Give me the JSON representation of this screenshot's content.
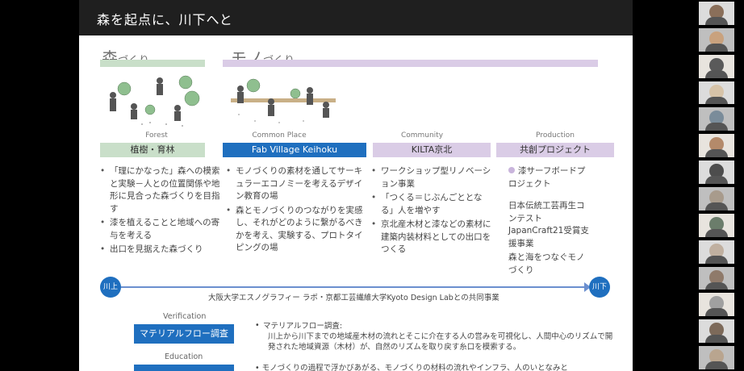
{
  "slide": {
    "title": "森を起点に、川下へと",
    "section_mori": {
      "main": "森",
      "sub": "づくり"
    },
    "section_mono": {
      "main": "モノ",
      "sub": "づくり"
    },
    "columns": [
      {
        "category": "Forest",
        "tag": "植樹・育林",
        "style": "green",
        "bullets": [
          "「理にかなった」森への模索と実験－人との位置関係や地形に見合った森づくりを目指す",
          "漆を植えることと地域への寄与を考える",
          "出口を見据えた森づくり"
        ]
      },
      {
        "category": "Common Place",
        "tag": "Fab Village Keihoku",
        "style": "blue",
        "bullets": [
          "モノづくりの素材を通してサーキュラーエコノミーを考えるデザイン教育の場",
          "森とモノづくりのつながりを実感し、それがどのように繋がるべきかを考え、実験する、プロトタイピングの場"
        ]
      },
      {
        "category": "Community",
        "tag": "KILTA京北",
        "style": "purple",
        "bullets": [
          "ワークショップ型リノベーション事業",
          "「つくる＝じぶんごととなる」人を増やす",
          "京北産木材と漆などの素材に建築内装材料としての出口をつくる"
        ]
      },
      {
        "category": "Production",
        "tag": "共創プロジェクト",
        "style": "purple",
        "items": [
          "漆サーフボードプロジェクト",
          "日本伝統工芸再生コンテストJapanCraft21受賞支援事業",
          "森と海をつなぐモノづくり"
        ]
      }
    ],
    "flow": {
      "start": "川上",
      "end": "川下",
      "caption": "大阪大学エスノグラフィー ラボ・京都工芸繊維大学Kyoto Design Labとの共同事業"
    },
    "verification": {
      "label": "Verification",
      "button": "マテリアルフロー調査",
      "heading": "マテリアルフロー調査:",
      "text": "川上から川下までの地域産木材の流れとそこに介在する人の営みを可視化し、人間中心のリズムで開発された地域資源（木材）が、自然のリズムを取り戻す糸口を模索する。"
    },
    "education": {
      "label": "Education",
      "text": "モノづくりの過程で浮かびあがる、モノづくりの材料の流れやインフラ、人のいとなみと"
    }
  },
  "participants": {
    "count": 14,
    "colors": [
      "#8a6f5a",
      "#c9a27e",
      "#5a5a5a",
      "#d6c3a8",
      "#7a8c9a",
      "#b48a6a",
      "#4d4d4d",
      "#a89b8c",
      "#6b7d6b",
      "#c0b0a0",
      "#8f7a6a",
      "#a0a0a0",
      "#7d6a5a",
      "#b9a58f"
    ]
  }
}
